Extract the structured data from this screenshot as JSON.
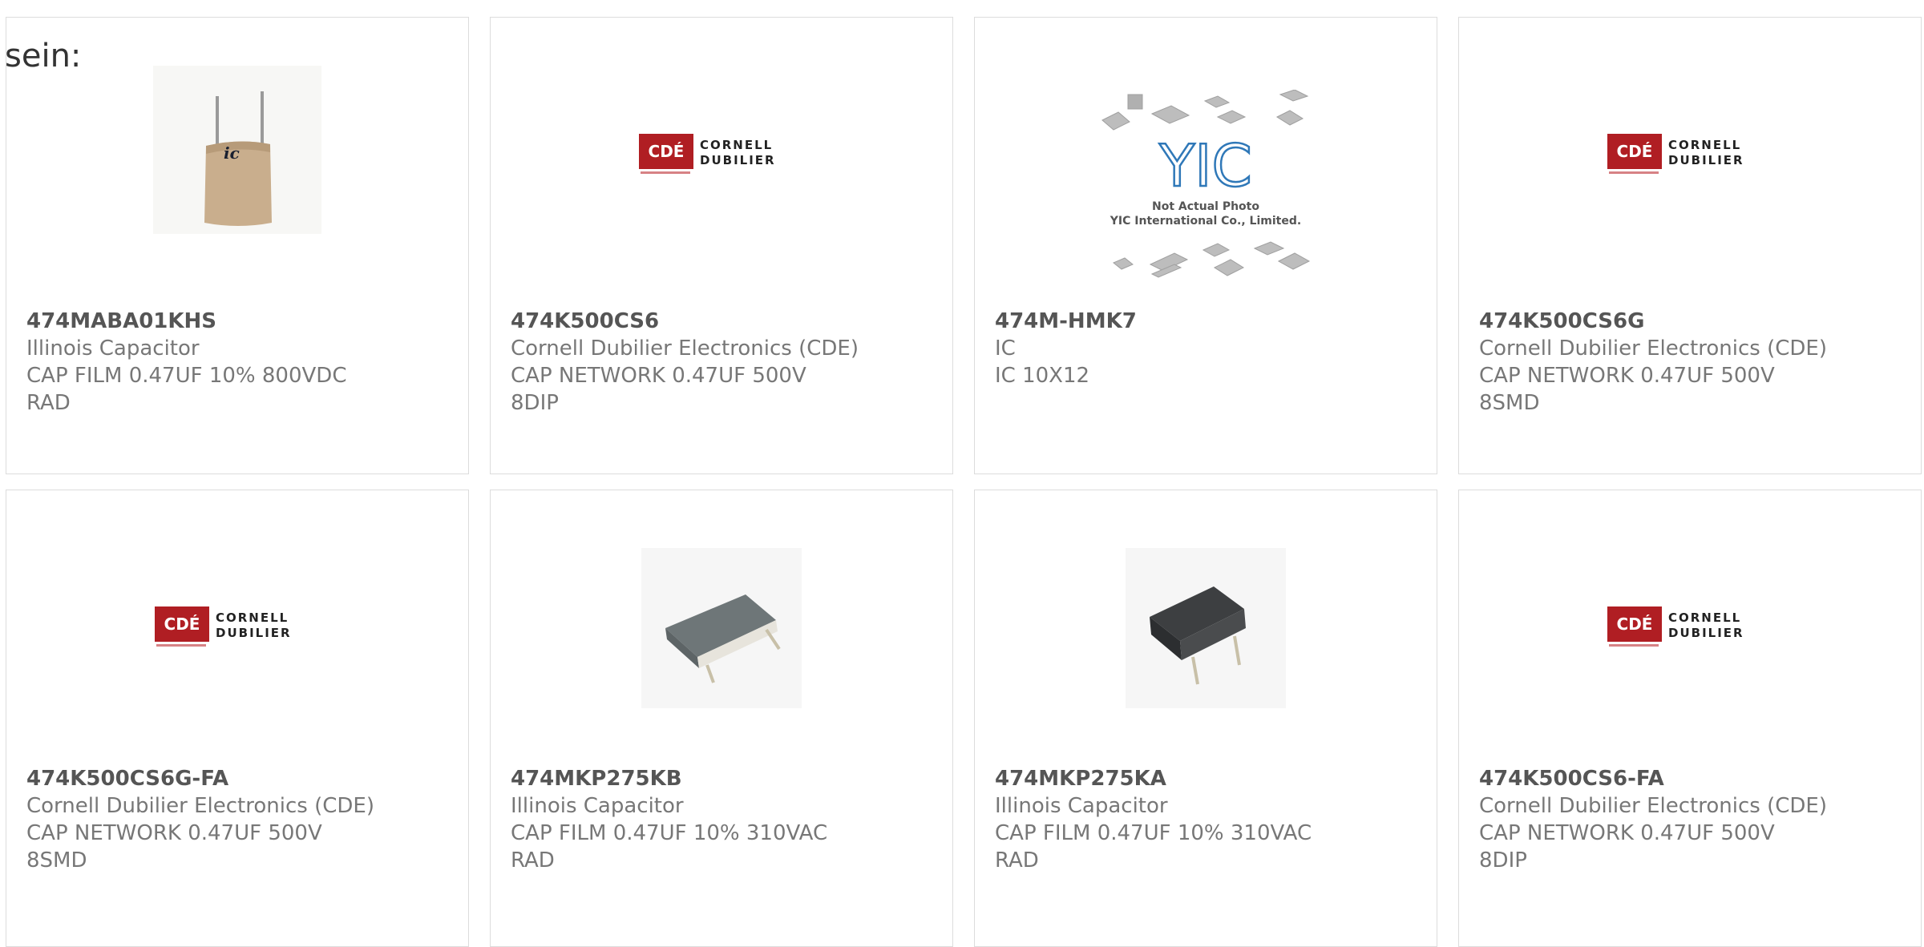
{
  "intro_text": "sein:",
  "products": [
    {
      "part": "474MABA01KHS",
      "maker": "Illinois Capacitor",
      "desc1": "CAP FILM 0.47UF 10% 800VDC",
      "desc2": "RAD",
      "image": "illinois-cap-photo",
      "logo_text": ""
    },
    {
      "part": "474K500CS6",
      "maker": "Cornell Dubilier Electronics (CDE)",
      "desc1": "CAP NETWORK 0.47UF 500V",
      "desc2": "8DIP",
      "image": "cde-logo",
      "logo_text": "CDE CORNELL DUBILIER"
    },
    {
      "part": "474M-HMK7",
      "maker": "IC",
      "desc1": "IC 10X12",
      "desc2": "",
      "image": "yic-placeholder",
      "logo_text": "YIC",
      "caption1": "Not Actual Photo",
      "caption2": "YIC International Co., Limited."
    },
    {
      "part": "474K500CS6G",
      "maker": "Cornell Dubilier Electronics (CDE)",
      "desc1": "CAP NETWORK 0.47UF 500V",
      "desc2": "8SMD",
      "image": "cde-logo",
      "logo_text": "CDE CORNELL DUBILIER"
    },
    {
      "part": "474K500CS6G-FA",
      "maker": "Cornell Dubilier Electronics (CDE)",
      "desc1": "CAP NETWORK 0.47UF 500V",
      "desc2": "8SMD",
      "image": "cde-logo",
      "logo_text": "CDE CORNELL DUBILIER"
    },
    {
      "part": "474MKP275KB",
      "maker": "Illinois Capacitor",
      "desc1": "CAP FILM 0.47UF 10% 310VAC",
      "desc2": "RAD",
      "image": "film-cap-photo-grey",
      "logo_text": ""
    },
    {
      "part": "474MKP275KA",
      "maker": "Illinois Capacitor",
      "desc1": "CAP FILM 0.47UF 10% 310VAC",
      "desc2": "RAD",
      "image": "film-cap-photo-dark",
      "logo_text": ""
    },
    {
      "part": "474K500CS6-FA",
      "maker": "Cornell Dubilier Electronics (CDE)",
      "desc1": "CAP NETWORK 0.47UF 500V",
      "desc2": "8DIP",
      "image": "cde-logo",
      "logo_text": "CDE CORNELL DUBILIER"
    }
  ],
  "colors": {
    "accent": "#e8410d",
    "bar": "#3e3e3e",
    "cde_red": "#b01e23"
  }
}
